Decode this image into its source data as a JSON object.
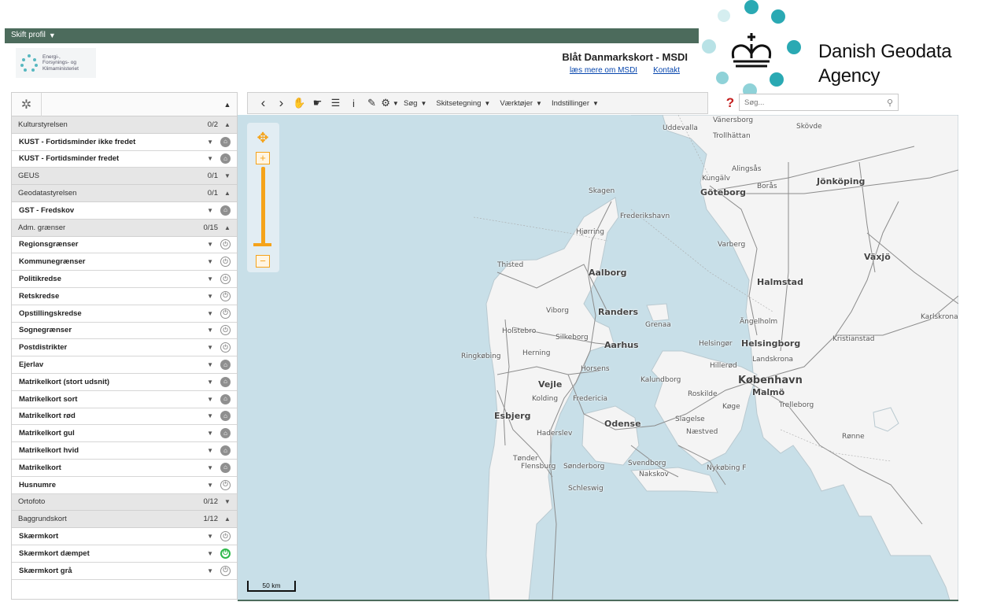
{
  "topbar": {
    "profile_label": "Skift profil"
  },
  "header": {
    "ministry_text": [
      "Energi-,",
      "Forsynings- og",
      "Klimaministeriet"
    ],
    "title": "Blåt Danmarkskort - MSDI",
    "link_more": "læs mere om MSDI",
    "link_contact": "Kontakt"
  },
  "agency_logo": {
    "line1": "Danish Geodata",
    "line2": "Agency"
  },
  "toolbar": {
    "menus": [
      "Søg",
      "Skitsetegning",
      "Værktøjer",
      "Indstillinger"
    ],
    "help": "?",
    "search_placeholder": "Søg..."
  },
  "sidebar": {
    "groups": [
      {
        "name": "Kulturstyrelsen",
        "count": "0/2",
        "state": "expanded",
        "layers": [
          {
            "name": "KUST - Fortidsminder ikke fredet",
            "icon": "lock-icon"
          },
          {
            "name": "KUST - Fortidsminder fredet",
            "icon": "lock-icon"
          }
        ]
      },
      {
        "name": "GEUS",
        "count": "0/1",
        "state": "collapsed",
        "layers": []
      },
      {
        "name": "Geodatastyrelsen",
        "count": "0/1",
        "state": "expanded",
        "layers": [
          {
            "name": "GST - Fredskov",
            "icon": "lock-icon"
          }
        ]
      },
      {
        "name": "Adm. grænser",
        "count": "0/15",
        "state": "expanded",
        "layers": [
          {
            "name": "Regionsgrænser",
            "icon": "power-icon"
          },
          {
            "name": "Kommunegrænser",
            "icon": "power-icon"
          },
          {
            "name": "Politikredse",
            "icon": "power-icon"
          },
          {
            "name": "Retskredse",
            "icon": "power-icon"
          },
          {
            "name": "Opstillingskredse",
            "icon": "power-icon"
          },
          {
            "name": "Sognegrænser",
            "icon": "power-icon"
          },
          {
            "name": "Postdistrikter",
            "icon": "power-icon"
          },
          {
            "name": "Ejerlav",
            "icon": "lock-icon"
          },
          {
            "name": "Matrikelkort (stort udsnit)",
            "icon": "lock-icon"
          },
          {
            "name": "Matrikelkort sort",
            "icon": "lock-icon"
          },
          {
            "name": "Matrikelkort rød",
            "icon": "lock-icon"
          },
          {
            "name": "Matrikelkort gul",
            "icon": "lock-icon"
          },
          {
            "name": "Matrikelkort hvid",
            "icon": "lock-icon"
          },
          {
            "name": "Matrikelkort",
            "icon": "lock-icon"
          },
          {
            "name": "Husnumre",
            "icon": "power-icon"
          }
        ]
      },
      {
        "name": "Ortofoto",
        "count": "0/12",
        "state": "collapsed",
        "layers": []
      },
      {
        "name": "Baggrundskort",
        "count": "1/12",
        "state": "expanded",
        "layers": [
          {
            "name": "Skærmkort",
            "icon": "power-icon"
          },
          {
            "name": "Skærmkort dæmpet",
            "icon": "power-on-icon"
          },
          {
            "name": "Skærmkort grå",
            "icon": "power-icon"
          }
        ]
      }
    ]
  },
  "map": {
    "scale_label": "50 km",
    "places": [
      "Uddevalla",
      "Vänersborg",
      "Trollhättan",
      "Skövde",
      "Alingsås",
      "Kungälv",
      "Borås",
      "Göteborg",
      "Jönköping",
      "Skagen",
      "Frederikshavn",
      "Hjørring",
      "Varberg",
      "Växjö",
      "Thisted",
      "Aalborg",
      "Halmstad",
      "Viborg",
      "Randers",
      "Grenaa",
      "Ängelholm",
      "Karlskrona",
      "Holstebro",
      "Silkeborg",
      "Aarhus",
      "Helsingør",
      "Helsingborg",
      "Kristianstad",
      "Ringkøbing",
      "Herning",
      "Landskrona",
      "Horsens",
      "Hillerød",
      "Vejle",
      "Kalundborg",
      "København",
      "Malmö",
      "Kolding",
      "Fredericia",
      "Roskilde",
      "Esbjerg",
      "Køge",
      "Trelleborg",
      "Odense",
      "Slagelse",
      "Haderslev",
      "Næstved",
      "Rønne",
      "Tønder",
      "Svendborg",
      "Flensburg",
      "Sønderborg",
      "Nakskov",
      "Nykøbing F",
      "Schleswig"
    ]
  }
}
